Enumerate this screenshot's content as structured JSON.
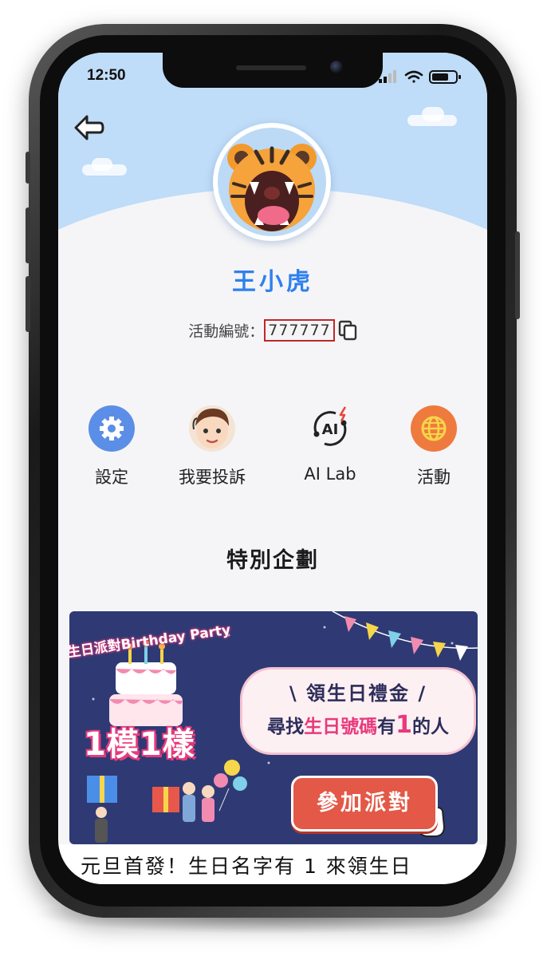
{
  "status_bar": {
    "time": "12:50"
  },
  "profile": {
    "name": "王小虎",
    "activity_id_label": "活動編號：",
    "activity_id": "777777"
  },
  "menu": [
    {
      "label": "設定",
      "icon": "gear-icon"
    },
    {
      "label": "我要投訴",
      "icon": "agent-avatar-icon"
    },
    {
      "label": "AI Lab",
      "icon": "ai-icon"
    },
    {
      "label": "活動",
      "icon": "globe-icon"
    }
  ],
  "section": {
    "title": "特別企劃"
  },
  "banner": {
    "party_title": "生日派對Birthday Party",
    "same_text": "1模1樣",
    "line1": "\\ 領生日禮金 /",
    "line2_prefix": "尋找",
    "line2_highlight": "生日號碼",
    "line2_mid": "有",
    "line2_num": "1",
    "line2_suffix": "的人",
    "button": "參加派對",
    "caption": "元旦首發！生日名字有 1 來領生日"
  },
  "colors": {
    "accent": "#2f80ed",
    "sky": "#bfdcf8",
    "highlight_box": "#c0262d",
    "banner_bg": "#2f3a74",
    "button": "#e35846"
  }
}
